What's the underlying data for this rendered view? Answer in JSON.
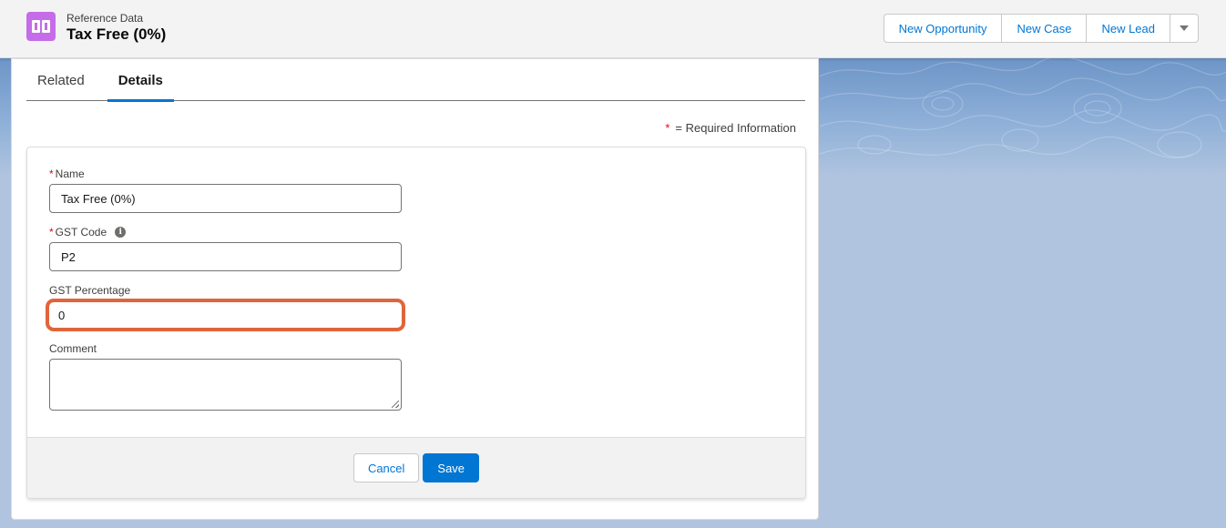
{
  "header": {
    "object_type": "Reference Data",
    "record_title": "Tax Free (0%)",
    "icon": "book-icon",
    "icon_color": "#c56ce8",
    "actions": [
      {
        "label": "New Opportunity"
      },
      {
        "label": "New Case"
      },
      {
        "label": "New Lead"
      }
    ],
    "more_actions_icon": "chevron-down-icon"
  },
  "tabs": [
    {
      "label": "Related",
      "active": false
    },
    {
      "label": "Details",
      "active": true
    }
  ],
  "required_note": {
    "star": "*",
    "text": "= Required Information"
  },
  "form": {
    "name": {
      "label": "Name",
      "required": true,
      "value": "Tax Free (0%)"
    },
    "gst_code": {
      "label": "GST Code",
      "required": true,
      "value": "P2",
      "help_icon": "info-icon"
    },
    "gst_percentage": {
      "label": "GST Percentage",
      "required": false,
      "value": "0",
      "highlight_color": "#e0653b"
    },
    "comment": {
      "label": "Comment",
      "required": false,
      "value": ""
    }
  },
  "footer": {
    "cancel_label": "Cancel",
    "save_label": "Save"
  },
  "colors": {
    "brand": "#0176d3",
    "required": "#ea001e",
    "background": "#b0c4df"
  }
}
